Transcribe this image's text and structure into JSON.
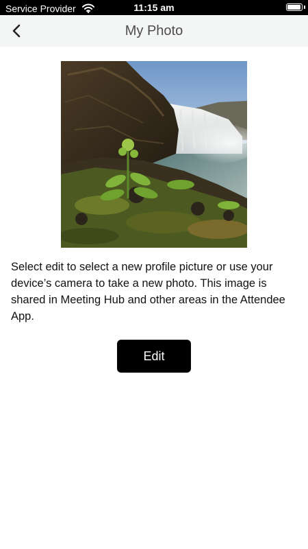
{
  "status_bar": {
    "carrier": "Service Provider",
    "time": "11:15 am",
    "battery_level": 0.95
  },
  "nav": {
    "title": "My Photo",
    "back_icon": "chevron-left-icon"
  },
  "profile_photo": {
    "description": "waterfall-landscape"
  },
  "content": {
    "description": "Select edit to select a new profile picture or use your device’s camera to take a new photo. This image is shared in Meeting Hub and other areas in the Attendee App."
  },
  "actions": {
    "edit_label": "Edit"
  }
}
